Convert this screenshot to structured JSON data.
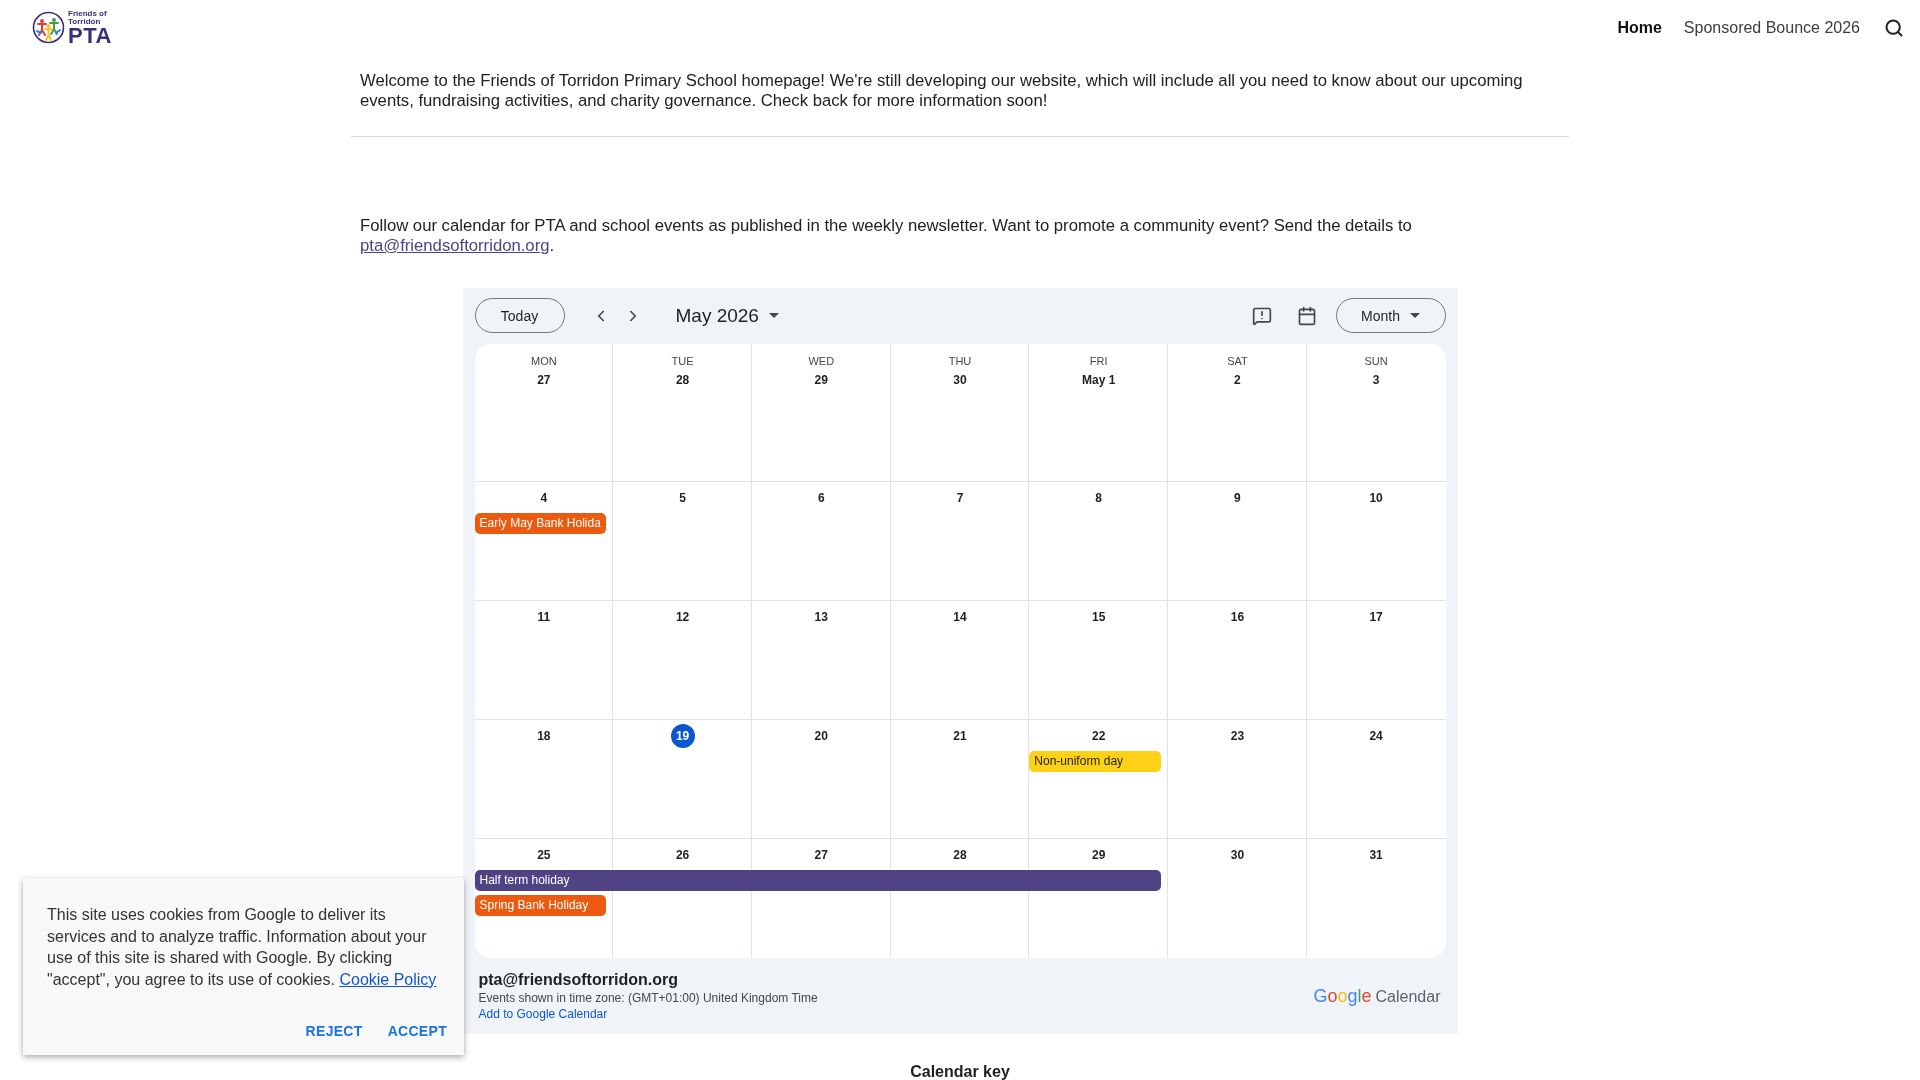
{
  "header": {
    "logo": {
      "lines": [
        "Friends of",
        "Torridon",
        "PTA"
      ]
    },
    "nav": [
      {
        "label": "Home",
        "selected": true
      },
      {
        "label": "Sponsored Bounce 2026",
        "selected": false
      }
    ]
  },
  "intro": "Welcome to the Friends of Torridon Primary School homepage! We're still developing our website, which will include all you need to know about our upcoming events, fundraising activities, and charity governance. Check back for more information soon!",
  "calendar_intro": {
    "text": "Follow our calendar for PTA and school events as published in the weekly newsletter. Want to promote a community event? Send the details to",
    "link": "pta@friendsoftorridon.org",
    "after": "."
  },
  "calendar": {
    "toolbar": {
      "today_button": "Today",
      "period": "May 2026",
      "view": "Month"
    },
    "weekdays": [
      "MON",
      "TUE",
      "WED",
      "THU",
      "FRI",
      "SAT",
      "SUN"
    ],
    "weeks": [
      {
        "days": [
          {
            "date": "27",
            "today": false
          },
          {
            "date": "28",
            "today": false
          },
          {
            "date": "29",
            "today": false
          },
          {
            "date": "30",
            "today": false
          },
          {
            "date": "May 1",
            "today": false
          },
          {
            "date": "2",
            "today": false
          },
          {
            "date": "3",
            "today": false
          }
        ]
      },
      {
        "days": [
          {
            "date": "4",
            "today": false,
            "events": [
              {
                "kind": "start",
                "title": "Early May Bank Holida",
                "color": "#ec5a0f"
              }
            ]
          },
          {
            "date": "5",
            "today": false
          },
          {
            "date": "6",
            "today": false
          },
          {
            "date": "7",
            "today": false
          },
          {
            "date": "8",
            "today": false
          },
          {
            "date": "9",
            "today": false
          },
          {
            "date": "10",
            "today": false
          }
        ]
      },
      {
        "days": [
          {
            "date": "11",
            "today": false
          },
          {
            "date": "12",
            "today": false
          },
          {
            "date": "13",
            "today": false
          },
          {
            "date": "14",
            "today": false
          },
          {
            "date": "15",
            "today": false
          },
          {
            "date": "16",
            "today": false
          },
          {
            "date": "17",
            "today": false
          }
        ]
      },
      {
        "days": [
          {
            "date": "18",
            "today": false
          },
          {
            "date": "19",
            "today": true
          },
          {
            "date": "20",
            "today": false
          },
          {
            "date": "21",
            "today": false
          },
          {
            "date": "22",
            "today": false,
            "events": [
              {
                "kind": "start",
                "title": "Non-uniform day",
                "color": "#fcd116"
              }
            ]
          },
          {
            "date": "23",
            "today": false
          },
          {
            "date": "24",
            "today": false
          }
        ]
      },
      {
        "days": [
          {
            "date": "25",
            "today": false,
            "events": [
              {
                "kind": "start",
                "title": "Half term holiday",
                "color": "#4f4285"
              },
              {
                "kind": "start",
                "title": "Spring Bank Holiday",
                "color": "#ec5a0f"
              }
            ]
          },
          {
            "date": "26",
            "today": false,
            "events": [
              {
                "kind": "continuation"
              }
            ]
          },
          {
            "date": "27",
            "today": false,
            "events": [
              {
                "kind": "continuation"
              }
            ]
          },
          {
            "date": "28",
            "today": false,
            "events": [
              {
                "kind": "continuation"
              }
            ]
          },
          {
            "date": "29",
            "today": false,
            "events": [
              {
                "kind": "continuation"
              }
            ]
          },
          {
            "date": "30",
            "today": false
          },
          {
            "date": "31",
            "today": false
          }
        ]
      }
    ],
    "footer": {
      "email": "pta@friendsoftorridon.org",
      "timezone_note": "Events shown in time zone: (GMT+01:00) United Kingdom Time",
      "add_link": "Add to Google Calendar",
      "logo_words": [
        "Google",
        "Calendar"
      ]
    }
  },
  "calendar_key": {
    "heading": "Calendar key"
  },
  "cookie_banner": {
    "text": "This site uses cookies from Google to deliver its services and to analyze traffic. Information about your use of this site is shared with Google. By clicking \"accept\", you agree to its use of cookies.",
    "link": "Cookie Policy",
    "buttons": [
      "REJECT",
      "ACCEPT"
    ]
  }
}
